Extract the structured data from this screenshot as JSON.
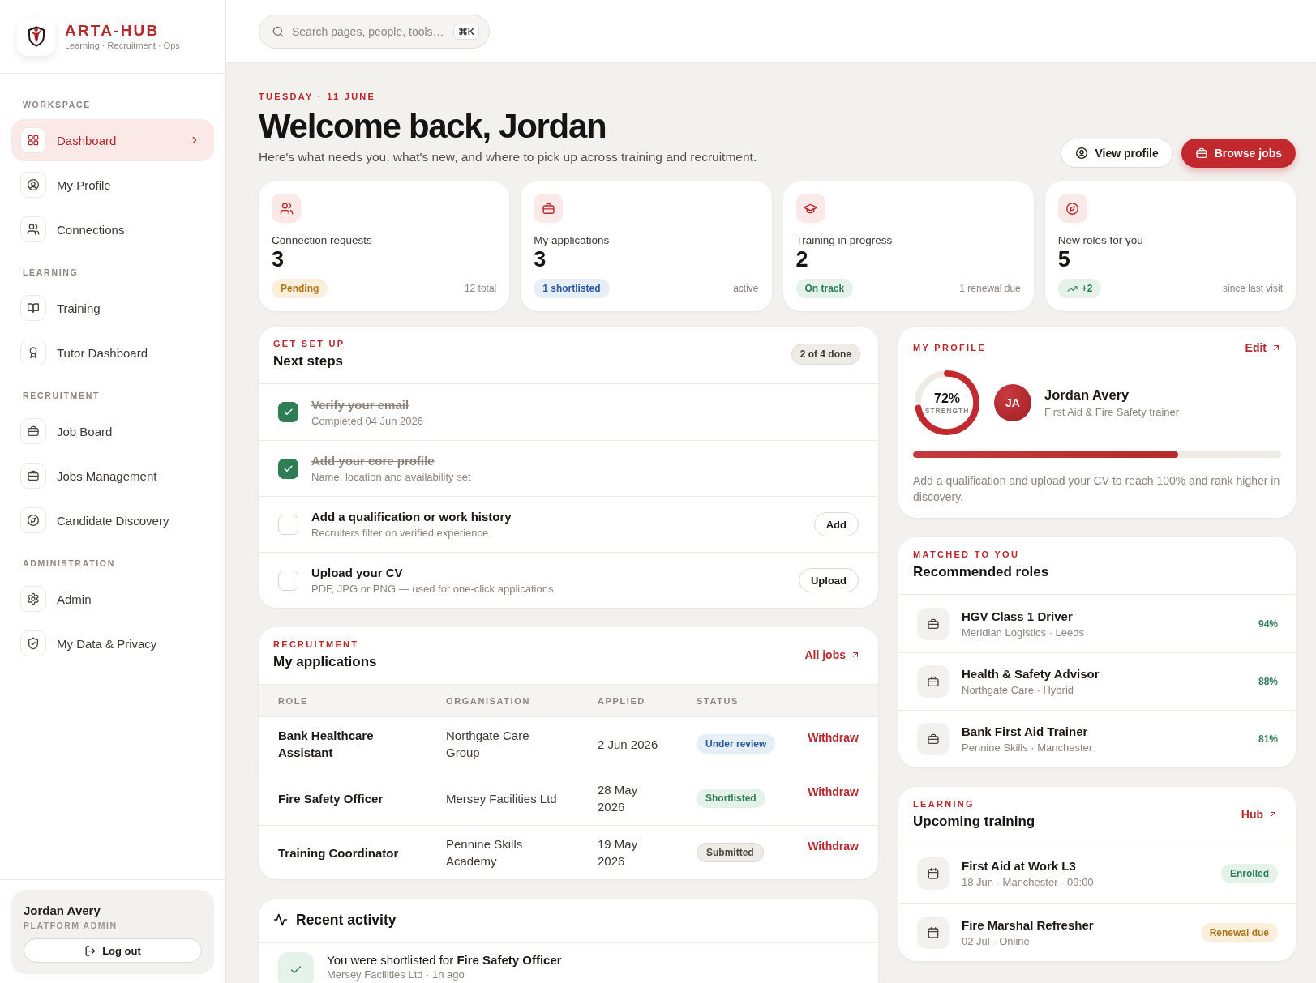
{
  "brand": {
    "name": "ARTA-HUB",
    "tagline": "Learning · Recruitment · Ops"
  },
  "sidebar": {
    "sections": [
      {
        "title": "WORKSPACE",
        "items": [
          {
            "label": "Dashboard",
            "selected": true
          },
          {
            "label": "My Profile",
            "selected": false
          },
          {
            "label": "Connections",
            "selected": false
          }
        ]
      },
      {
        "title": "LEARNING",
        "items": [
          {
            "label": "Training",
            "selected": false
          },
          {
            "label": "Tutor Dashboard",
            "selected": false
          }
        ]
      },
      {
        "title": "RECRUITMENT",
        "items": [
          {
            "label": "Job Board",
            "selected": false
          },
          {
            "label": "Jobs Management",
            "selected": false
          },
          {
            "label": "Candidate Discovery",
            "selected": false
          }
        ]
      },
      {
        "title": "ADMINISTRATION",
        "items": [
          {
            "label": "Admin",
            "selected": false
          },
          {
            "label": "My Data & Privacy",
            "selected": false
          }
        ]
      }
    ]
  },
  "user": {
    "name": "Jordan Avery",
    "role": "PLATFORM ADMIN",
    "logout": "Log out"
  },
  "search": {
    "placeholder": "Search pages, people, tools…",
    "shortcut": "⌘K"
  },
  "header": {
    "date": "TUESDAY · 11 JUNE",
    "title": "Welcome back, Jordan",
    "subtitle": "Here's what needs you, what's new, and where to pick up across training and recruitment.",
    "buttons": [
      {
        "label": "View profile",
        "kind": "secondary"
      },
      {
        "label": "Browse jobs",
        "kind": "primary"
      }
    ]
  },
  "stats": [
    {
      "label": "Connection requests",
      "value": "3",
      "badge": {
        "text": "Pending",
        "kind": "warning"
      },
      "note": "12 total"
    },
    {
      "label": "My applications",
      "value": "3",
      "badge": {
        "text": "1 shortlisted",
        "kind": "info"
      },
      "note": "active"
    },
    {
      "label": "Training in progress",
      "value": "2",
      "badge": {
        "text": "On track",
        "kind": "success"
      },
      "note": "1 renewal due"
    },
    {
      "label": "New roles for you",
      "value": "5",
      "badge": {
        "text": "+2",
        "kind": "trend"
      },
      "note": "since last visit"
    }
  ],
  "next_steps": {
    "eyebrow": "GET SET UP",
    "title": "Next steps",
    "progress": "2 of 4 done",
    "items": [
      {
        "title": "Verify your email",
        "detail": "Completed 04 Jun 2026",
        "checked": true
      },
      {
        "title": "Add your core profile",
        "detail": "Name, location and availability set",
        "checked": true
      },
      {
        "title": "Add a qualification or work history",
        "detail": "Recruiters filter on verified experience",
        "checked": false,
        "action": "Add"
      },
      {
        "title": "Upload your CV",
        "detail": "PDF, JPG or PNG — used for one-click applications",
        "checked": false,
        "action": "Upload"
      }
    ]
  },
  "applications": {
    "eyebrow": "RECRUITMENT",
    "title": "My applications",
    "link": "All jobs",
    "columns": [
      "ROLE",
      "ORGANISATION",
      "APPLIED",
      "STATUS"
    ],
    "rows": [
      {
        "role": "Bank Healthcare Assistant",
        "organisation": "Northgate Care Group",
        "applied": "2 Jun 2026",
        "status": {
          "text": "Under review",
          "kind": "info"
        },
        "action": "Withdraw"
      },
      {
        "role": "Fire Safety Officer",
        "organisation": "Mersey Facilities Ltd",
        "applied": "28 May 2026",
        "status": {
          "text": "Shortlisted",
          "kind": "success"
        },
        "action": "Withdraw"
      },
      {
        "role": "Training Coordinator",
        "organisation": "Pennine Skills Academy",
        "applied": "19 May 2026",
        "status": {
          "text": "Submitted",
          "kind": "neutral"
        },
        "action": "Withdraw"
      }
    ]
  },
  "activity": {
    "title": "Recent activity",
    "items": [
      {
        "text": "You were shortlisted for **Fire Safety Officer**",
        "detail": "Mersey Facilities Ltd · 1h ago"
      }
    ]
  },
  "profile": {
    "eyebrow": "MY PROFILE",
    "link": "Edit",
    "strength": {
      "value": "72%",
      "label": "STRENGTH",
      "level": 0.72
    },
    "initials": "JA",
    "name": "Jordan Avery",
    "headline": "First Aid & Fire Safety trainer",
    "bar": {
      "level": 0.72
    },
    "hint": "Add a qualification and upload your CV to reach 100% and rank higher in discovery."
  },
  "recommended": {
    "eyebrow": "MATCHED TO YOU",
    "title": "Recommended roles",
    "items": [
      {
        "title": "HGV Class 1 Driver",
        "detail": "Meridian Logistics · Leeds",
        "match": "94%"
      },
      {
        "title": "Health & Safety Advisor",
        "detail": "Northgate Care · Hybrid",
        "match": "88%"
      },
      {
        "title": "Bank First Aid Trainer",
        "detail": "Pennine Skills · Manchester",
        "match": "81%"
      }
    ]
  },
  "training": {
    "eyebrow": "LEARNING",
    "title": "Upcoming training",
    "link": "Hub",
    "items": [
      {
        "title": "First Aid at Work L3",
        "detail": "18 Jun · Manchester · 09:00",
        "badge": {
          "text": "Enrolled",
          "kind": "success"
        }
      },
      {
        "title": "Fire Marshal Refresher",
        "detail": "02 Jul · Online",
        "badge": {
          "text": "Renewal due",
          "kind": "warning"
        }
      }
    ]
  }
}
